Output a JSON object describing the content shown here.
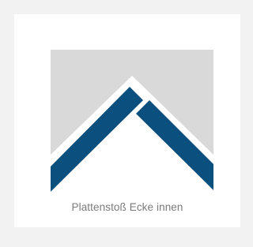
{
  "caption": "Plattenstoß Ecke innen",
  "colors": {
    "page_background": "#f2f2f2",
    "card_background": "#ffffff",
    "panel_gray": "#d9d9d9",
    "plate_blue": "#0b4f7f",
    "caption_text": "#7a7a7a"
  },
  "icons": {
    "illustration": "inner-corner-plate-joint-icon"
  }
}
